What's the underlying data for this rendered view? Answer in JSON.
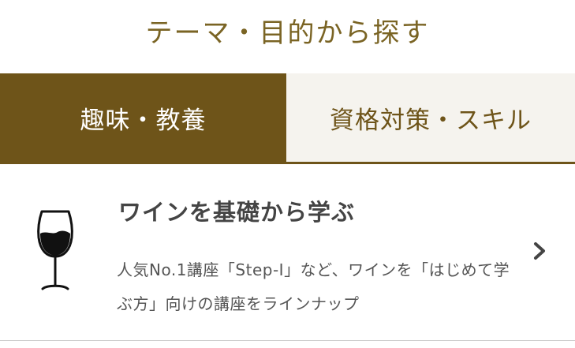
{
  "header": {
    "title": "テーマ・目的から探す"
  },
  "tabs": [
    {
      "label": "趣味・教養",
      "active": true
    },
    {
      "label": "資格対策・スキル",
      "active": false
    }
  ],
  "course_card": {
    "icon": "wine-glass-icon",
    "title": "ワインを基礎から学ぶ",
    "description": "人気No.1講座「Step-Ⅰ」など、ワインを「はじめて学ぶ方」向けの講座をラインナップ",
    "chevron_icon": "chevron-right-icon"
  },
  "colors": {
    "brand": "#6e5419",
    "title_text": "#7a6424",
    "inactive_tab_bg": "#f5f3ee",
    "body_text": "#555555",
    "heading_text": "#444444"
  }
}
